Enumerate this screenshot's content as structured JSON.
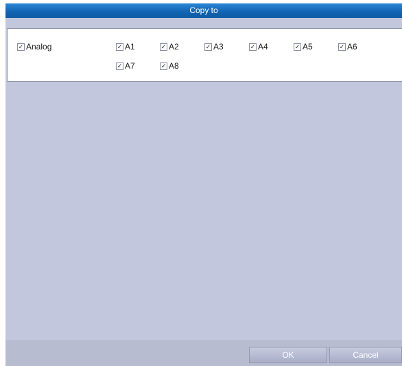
{
  "dialog": {
    "title": "Copy to",
    "group": {
      "label": "Analog",
      "checked": true
    },
    "channels": [
      {
        "label": "A1",
        "checked": true
      },
      {
        "label": "A2",
        "checked": true
      },
      {
        "label": "A3",
        "checked": true
      },
      {
        "label": "A4",
        "checked": true
      },
      {
        "label": "A5",
        "checked": true
      },
      {
        "label": "A6",
        "checked": true
      },
      {
        "label": "A7",
        "checked": true
      },
      {
        "label": "A8",
        "checked": true
      }
    ],
    "buttons": {
      "ok": "OK",
      "cancel": "Cancel"
    }
  },
  "icons": {
    "checkbox": "check-icon"
  },
  "colors": {
    "titlebar": "#1266b4",
    "background": "#c2c7dd",
    "panel": "#ffffff"
  }
}
